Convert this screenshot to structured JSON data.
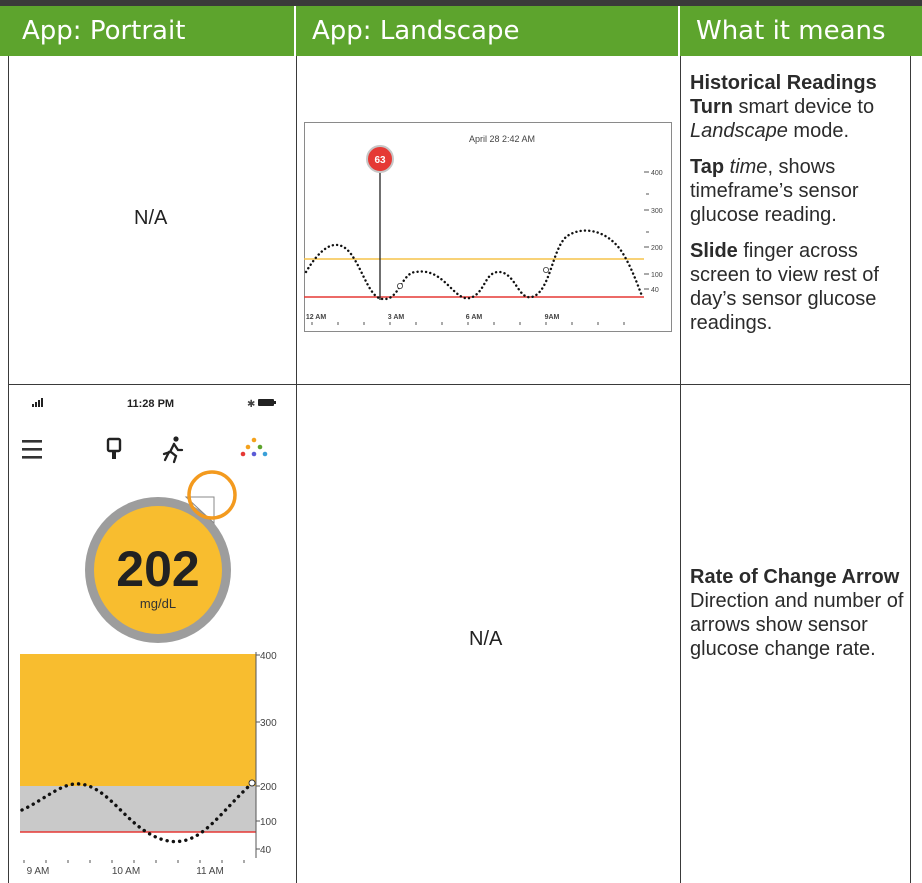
{
  "headers": {
    "portrait": "App: Portrait",
    "landscape": "App: Landscape",
    "meaning": "What it means"
  },
  "row1": {
    "portrait": "N/A",
    "landscape_chart": {
      "date": "April 28   2:42 AM",
      "reading": "63",
      "yticks": [
        "400",
        "300",
        "200",
        "100",
        "40"
      ],
      "xticks": [
        "12 AM",
        "3 AM",
        "6 AM",
        "9AM"
      ]
    },
    "meaning": {
      "title": "Historical Readings",
      "p1_bold": "Turn",
      "p1_rest": " smart device to ",
      "p1_italic": "Landscape",
      "p1_end": " mode.",
      "p2_bold": "Tap",
      "p2_italic": "time",
      "p2_rest": ", shows timeframe’s sensor glucose reading.",
      "p3_bold": "Slide",
      "p3_rest": " finger across screen to view rest of day’s sensor glucose readings."
    }
  },
  "row2": {
    "phone": {
      "status_time": "11:28 PM",
      "glucose_value": "202",
      "glucose_unit": "mg/dL",
      "yticks": [
        "400",
        "300",
        "200",
        "100",
        "40"
      ],
      "xticks": [
        "9 AM",
        "10 AM",
        "11 AM"
      ],
      "colors": {
        "yellow": "#f8bd2f",
        "gray": "#c9c9c9",
        "orange": "#f39a1e",
        "red": "#e53935"
      }
    },
    "landscape": "N/A",
    "meaning": {
      "title": "Rate of Change Arrow",
      "body": "Direction and number of arrows show sensor glucose change rate."
    }
  }
}
